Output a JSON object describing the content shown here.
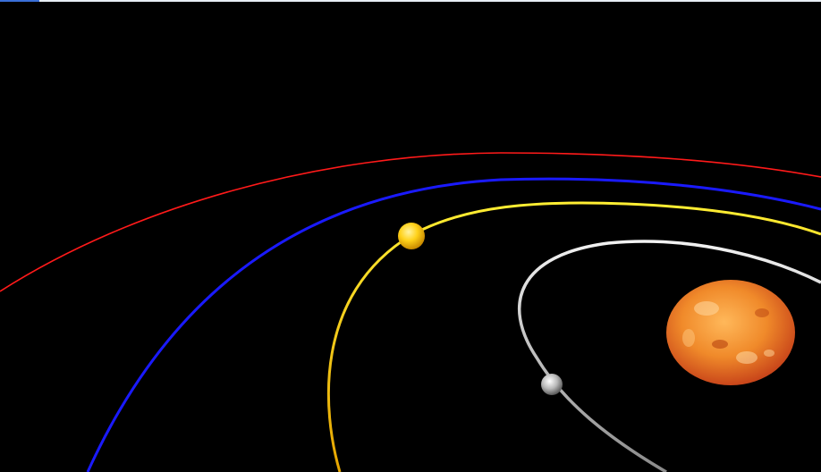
{
  "scene": {
    "background": "#000000",
    "colors": {
      "sun_core": "#f7a23a",
      "sun_edge": "#d9541a",
      "sun_spot": "#ffd9a0",
      "orbit_outer": "#ff1a1a",
      "orbit_second": "#1a1aff",
      "orbit_third": "#ffe21a",
      "orbit_inner": "#e6e6e6",
      "planet_yellow": "#ffd21a",
      "planet_grey": "#b8b8b8",
      "top_strip": "#e8eef5",
      "top_strip_accent": "#3a6fd8"
    },
    "icons": {
      "sun": "sun-icon",
      "planet_yellow": "planet-icon",
      "planet_grey": "moon-icon"
    }
  }
}
